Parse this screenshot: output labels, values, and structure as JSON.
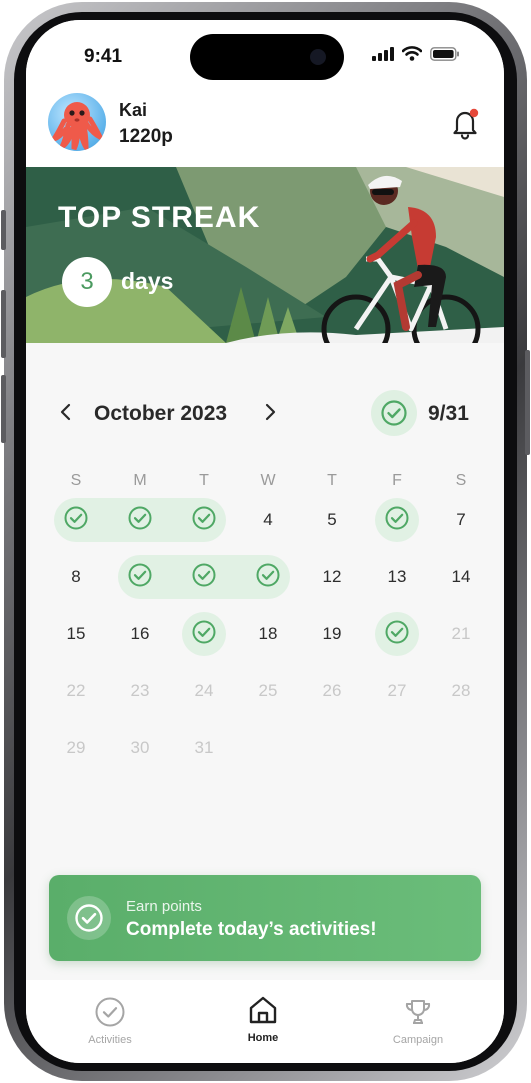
{
  "status": {
    "time": "9:41"
  },
  "user": {
    "name": "Kai",
    "points": "1220p"
  },
  "banner": {
    "title": "TOP STREAK",
    "streak_count": "3",
    "streak_unit": "days"
  },
  "calendar": {
    "month": "October 2023",
    "completed": "9/31",
    "weekdays": [
      "S",
      "M",
      "T",
      "W",
      "T",
      "F",
      "S"
    ],
    "weeks": [
      [
        {
          "d": "1",
          "done": true
        },
        {
          "d": "2",
          "done": true
        },
        {
          "d": "3",
          "done": true
        },
        {
          "d": "4"
        },
        {
          "d": "5"
        },
        {
          "d": "6",
          "done": true
        },
        {
          "d": "7"
        }
      ],
      [
        {
          "d": "8"
        },
        {
          "d": "9",
          "done": true
        },
        {
          "d": "10",
          "done": true
        },
        {
          "d": "11",
          "done": true
        },
        {
          "d": "12"
        },
        {
          "d": "13"
        },
        {
          "d": "14"
        }
      ],
      [
        {
          "d": "15"
        },
        {
          "d": "16"
        },
        {
          "d": "17",
          "done": true
        },
        {
          "d": "18"
        },
        {
          "d": "19"
        },
        {
          "d": "20",
          "done": true
        },
        {
          "d": "21",
          "muted": true
        }
      ],
      [
        {
          "d": "22",
          "muted": true
        },
        {
          "d": "23",
          "muted": true
        },
        {
          "d": "24",
          "muted": true
        },
        {
          "d": "25",
          "muted": true
        },
        {
          "d": "26",
          "muted": true
        },
        {
          "d": "27",
          "muted": true
        },
        {
          "d": "28",
          "muted": true
        }
      ],
      [
        {
          "d": "29",
          "muted": true
        },
        {
          "d": "30",
          "muted": true
        },
        {
          "d": "31",
          "muted": true
        }
      ]
    ]
  },
  "earn_card": {
    "kicker": "Earn points",
    "message": "Complete today’s activities!"
  },
  "tabs": [
    {
      "label": "Activities",
      "icon": "check-circle-icon",
      "active": false
    },
    {
      "label": "Home",
      "icon": "home-icon",
      "active": true
    },
    {
      "label": "Campaign",
      "icon": "trophy-icon",
      "active": false
    }
  ],
  "colors": {
    "accent": "#5aae6a",
    "done_bg": "#e1f1e4",
    "check": "#4fa865",
    "notification": "#e5483a"
  }
}
